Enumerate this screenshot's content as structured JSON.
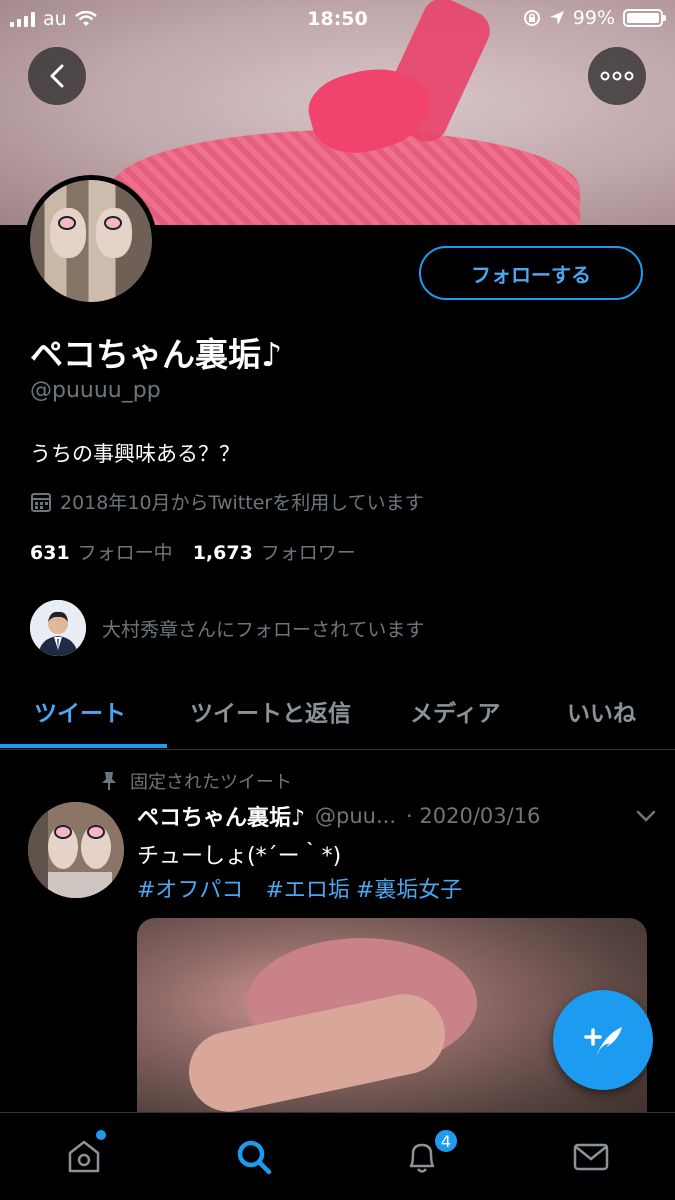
{
  "status_bar": {
    "carrier": "au",
    "time": "18:50",
    "battery": "99%"
  },
  "profile": {
    "display_name": "ペコちゃん裏垢♪",
    "handle": "@puuuu_pp",
    "bio": "うちの事興味ある？？",
    "joined": "2018年10月からTwitterを利用しています",
    "following_count": "631",
    "following_label": "フォロー中",
    "followers_count": "1,673",
    "followers_label": "フォロワー",
    "followed_by_text": "大村秀章さんにフォローされています",
    "follow_button_label": "フォローする"
  },
  "tabs": [
    {
      "label": "ツイート",
      "active": true
    },
    {
      "label": "ツイートと返信",
      "active": false
    },
    {
      "label": "メディア",
      "active": false
    },
    {
      "label": "いいね",
      "active": false
    }
  ],
  "pinned_tweet": {
    "pinned_label": "固定されたツイート",
    "name": "ペコちゃん裏垢♪",
    "handle": "@puu...",
    "date": "· 2020/03/16",
    "text": "チューしょ(*´ー｀*)",
    "hashtags": [
      "#オフパコ",
      "#エロ垢",
      "#裏垢女子"
    ]
  },
  "bottom_nav": {
    "notifications_badge": "4"
  },
  "colors": {
    "accent": "#1d9bf0",
    "background": "#000000",
    "secondary_text": "#6e767d"
  },
  "icons": [
    "back-icon",
    "more-icon",
    "calendar-icon",
    "pin-icon",
    "chevron-down-icon",
    "compose-icon",
    "home-icon",
    "search-icon",
    "bell-icon",
    "mail-icon"
  ]
}
